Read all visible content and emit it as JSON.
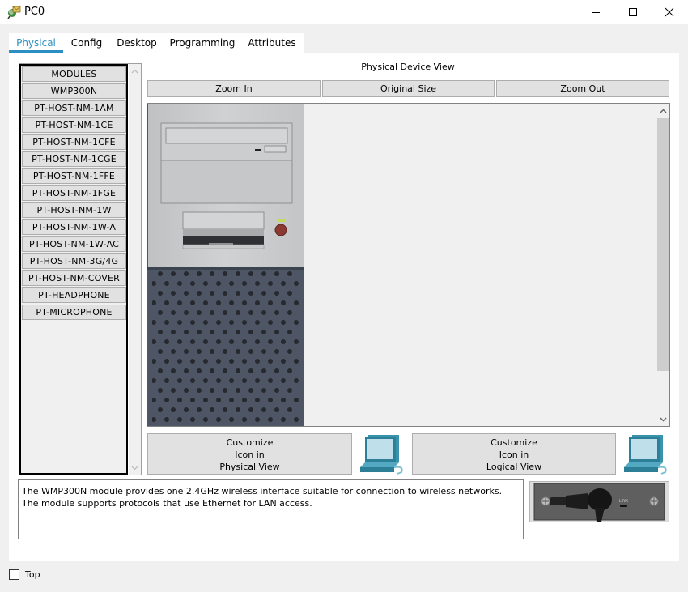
{
  "window": {
    "title": "PC0",
    "icon": "packet-tracer-pc-icon",
    "controls": {
      "minimize": "minimize-icon",
      "maximize": "maximize-icon",
      "close": "close-icon"
    }
  },
  "tabs": [
    {
      "label": "Physical",
      "active": true
    },
    {
      "label": "Config",
      "active": false
    },
    {
      "label": "Desktop",
      "active": false
    },
    {
      "label": "Programming",
      "active": false
    },
    {
      "label": "Attributes",
      "active": false
    }
  ],
  "modules": {
    "items": [
      "MODULES",
      "WMP300N",
      "PT-HOST-NM-1AM",
      "PT-HOST-NM-1CE",
      "PT-HOST-NM-1CFE",
      "PT-HOST-NM-1CGE",
      "PT-HOST-NM-1FFE",
      "PT-HOST-NM-1FGE",
      "PT-HOST-NM-1W",
      "PT-HOST-NM-1W-A",
      "PT-HOST-NM-1W-AC",
      "PT-HOST-NM-3G/4G",
      "PT-HOST-NM-COVER",
      "PT-HEADPHONE",
      "PT-MICROPHONE"
    ]
  },
  "device_view": {
    "label": "Physical Device View",
    "zoom_in": "Zoom In",
    "original_size": "Original Size",
    "zoom_out": "Zoom Out"
  },
  "customize": {
    "physical": [
      "Customize",
      "Icon in",
      "Physical View"
    ],
    "logical": [
      "Customize",
      "Icon in",
      "Logical View"
    ]
  },
  "description": "The WMP300N module provides one 2.4GHz wireless interface suitable for connection to wireless networks. The module supports protocols that use Ethernet for LAN access.",
  "module_image": {
    "link_label": "LINK"
  },
  "footer": {
    "top_checkbox_label": "Top",
    "top_checked": false
  }
}
